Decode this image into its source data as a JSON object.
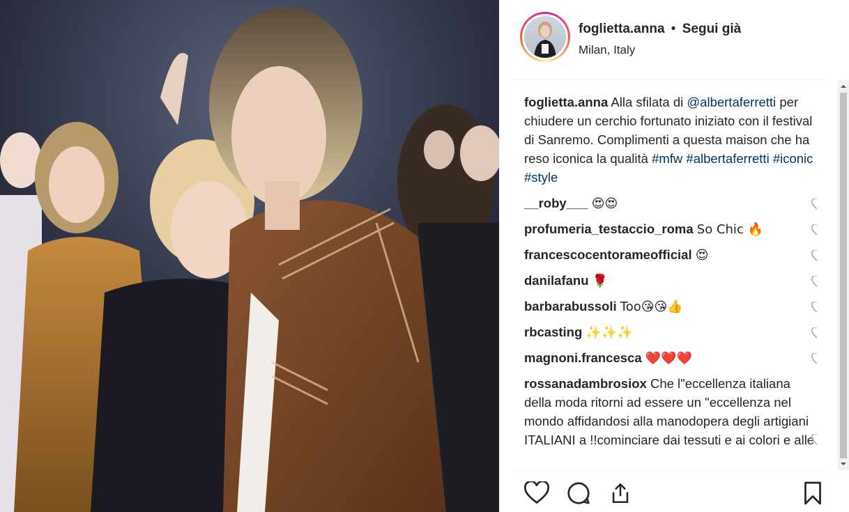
{
  "post": {
    "username": "foglietta.anna",
    "separator": "•",
    "follow_status": "Segui già",
    "location": "Milan, Italy"
  },
  "caption": {
    "user": "foglietta.anna",
    "text_before": "Alla sfilata di",
    "mention": "@albertaferretti",
    "text_after": "per chiudere un cerchio fortunato iniziato con il festival di Sanremo. Complimenti a questa maison che ha reso iconica la qualità",
    "hashtags": "#mfw #albertaferretti #iconic #style"
  },
  "comments": [
    {
      "user": "__roby___",
      "text": "😍😍"
    },
    {
      "user": "profumeria_testaccio_roma",
      "text": "So Chic 🔥"
    },
    {
      "user": "francescocentorameofficial",
      "text": "😍"
    },
    {
      "user": "danilafanu",
      "text": "🌹"
    },
    {
      "user": "barbarabussoli",
      "text": "Too😘😘👍"
    },
    {
      "user": "rbcasting",
      "text": "✨✨✨"
    },
    {
      "user": "magnoni.francesca",
      "text": "❤️❤️❤️"
    },
    {
      "user": "rossanadambrosiox",
      "text": "Che l\"eccellenza italiana della moda ritorni ad essere un \"eccellenza nel mondo affidandosi alla manodopera degli artigiani ITALIANI a !!cominciare dai tessuti e ai colori e alle"
    }
  ],
  "icons": {
    "like": "heart-icon",
    "comment": "comment-icon",
    "share": "share-icon",
    "save": "bookmark-icon"
  },
  "colors": {
    "link": "#003569",
    "text": "#262626"
  }
}
